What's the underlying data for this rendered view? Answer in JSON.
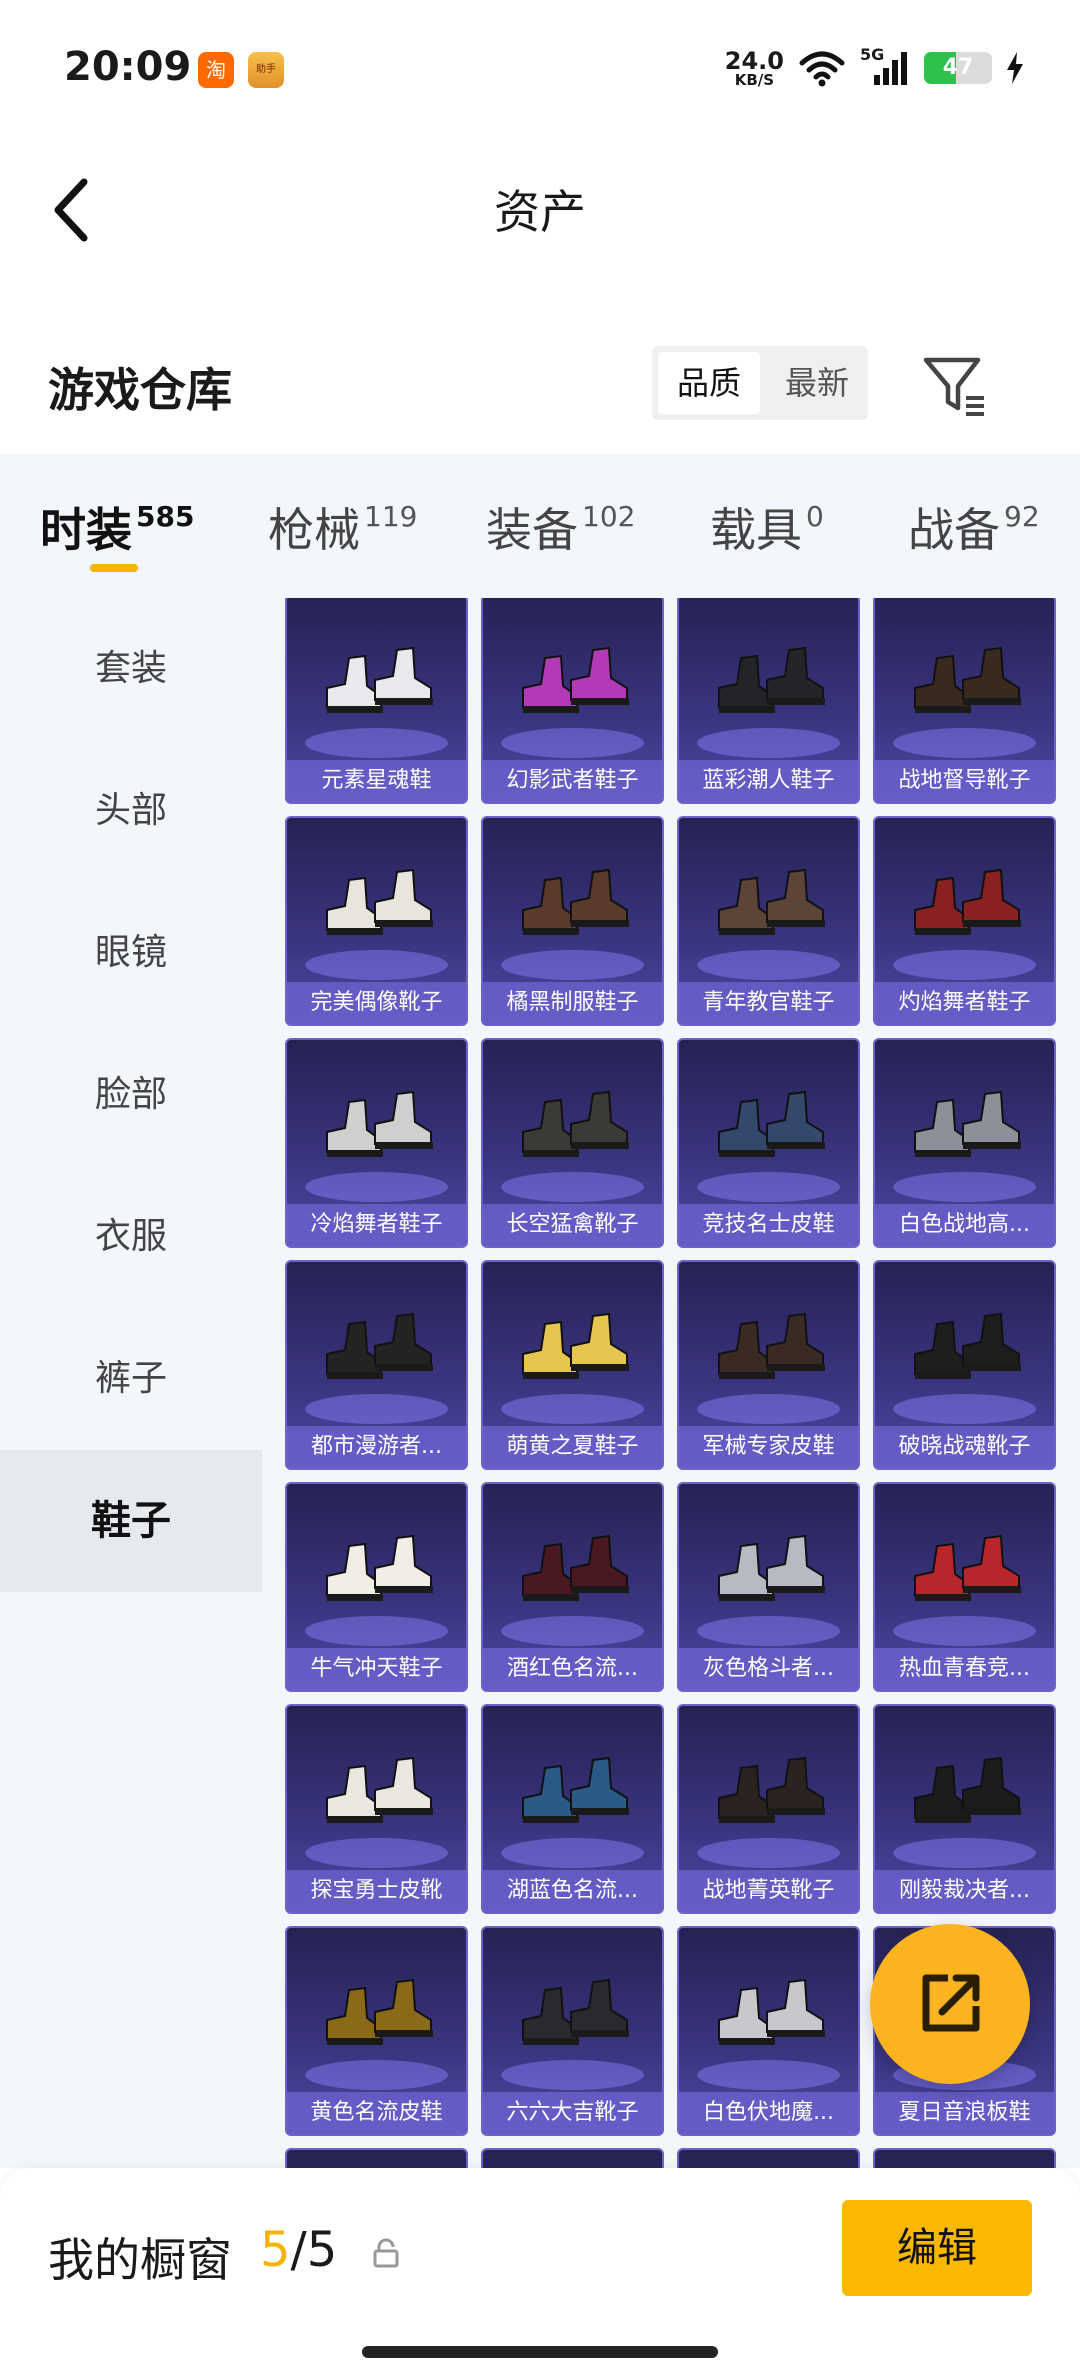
{
  "status_bar": {
    "time": "20:09",
    "app_icons": [
      "taobao-icon",
      "game-helper-icon"
    ],
    "taobao_glyph": "淘",
    "game_glyph": "助手",
    "net_speed": "24.0",
    "net_unit": "KB/S",
    "signal": "5G",
    "battery": "47",
    "battery_level": 0.47
  },
  "nav": {
    "title": "资产"
  },
  "warehouse": {
    "title": "游戏仓库",
    "sort_options": [
      "品质",
      "最新"
    ],
    "selected_sort": "品质"
  },
  "tabs": [
    {
      "label": "时装",
      "count": "585",
      "active": true
    },
    {
      "label": "枪械",
      "count": "119",
      "active": false
    },
    {
      "label": "装备",
      "count": "102",
      "active": false
    },
    {
      "label": "载具",
      "count": "0",
      "active": false
    },
    {
      "label": "战备",
      "count": "92",
      "active": false
    }
  ],
  "sidebar": [
    {
      "label": "套装",
      "active": false
    },
    {
      "label": "头部",
      "active": false
    },
    {
      "label": "眼镜",
      "active": false
    },
    {
      "label": "脸部",
      "active": false
    },
    {
      "label": "衣服",
      "active": false
    },
    {
      "label": "裤子",
      "active": false
    },
    {
      "label": "鞋子",
      "active": true
    }
  ],
  "items": [
    {
      "name": "元素星魂鞋",
      "color": "#e8e8ee"
    },
    {
      "name": "幻影武者鞋子",
      "color": "#b23ab8"
    },
    {
      "name": "蓝彩潮人鞋子",
      "color": "#222428"
    },
    {
      "name": "战地督导靴子",
      "color": "#3a2a1e"
    },
    {
      "name": "完美偶像靴子",
      "color": "#e9e4dc"
    },
    {
      "name": "橘黑制服鞋子",
      "color": "#5a3a2a"
    },
    {
      "name": "青年教官鞋子",
      "color": "#5c4438"
    },
    {
      "name": "灼焰舞者鞋子",
      "color": "#8a2020"
    },
    {
      "name": "冷焰舞者鞋子",
      "color": "#cfcfcf"
    },
    {
      "name": "长空猛禽靴子",
      "color": "#3c3a36"
    },
    {
      "name": "竞技名士皮鞋",
      "color": "#33486a"
    },
    {
      "name": "白色战地高...",
      "color": "#8d9098"
    },
    {
      "name": "都市漫游者...",
      "color": "#232323"
    },
    {
      "name": "萌黄之夏鞋子",
      "color": "#e6c650"
    },
    {
      "name": "军械专家皮鞋",
      "color": "#3a2a24"
    },
    {
      "name": "破晓战魂靴子",
      "color": "#1e1e20"
    },
    {
      "name": "牛气冲天鞋子",
      "color": "#f2ede6"
    },
    {
      "name": "酒红色名流...",
      "color": "#4a1820"
    },
    {
      "name": "灰色格斗者...",
      "color": "#b6bac2"
    },
    {
      "name": "热血青春竞...",
      "color": "#b8262c"
    },
    {
      "name": "探宝勇士皮靴",
      "color": "#eae6e0"
    },
    {
      "name": "湖蓝色名流...",
      "color": "#2a5a86"
    },
    {
      "name": "战地菁英靴子",
      "color": "#2a2220"
    },
    {
      "name": "刚毅裁决者...",
      "color": "#1c1c1e"
    },
    {
      "name": "黄色名流皮鞋",
      "color": "#8a6a18"
    },
    {
      "name": "六六大吉靴子",
      "color": "#2a2a2e"
    },
    {
      "name": "白色伏地魔...",
      "color": "#c8c8cc"
    },
    {
      "name": "夏日音浪板鞋",
      "color": "#d8d8dc"
    }
  ],
  "showcase": {
    "label": "我的橱窗",
    "current": "5",
    "separator": "/",
    "total": "5",
    "edit_label": "编辑"
  }
}
